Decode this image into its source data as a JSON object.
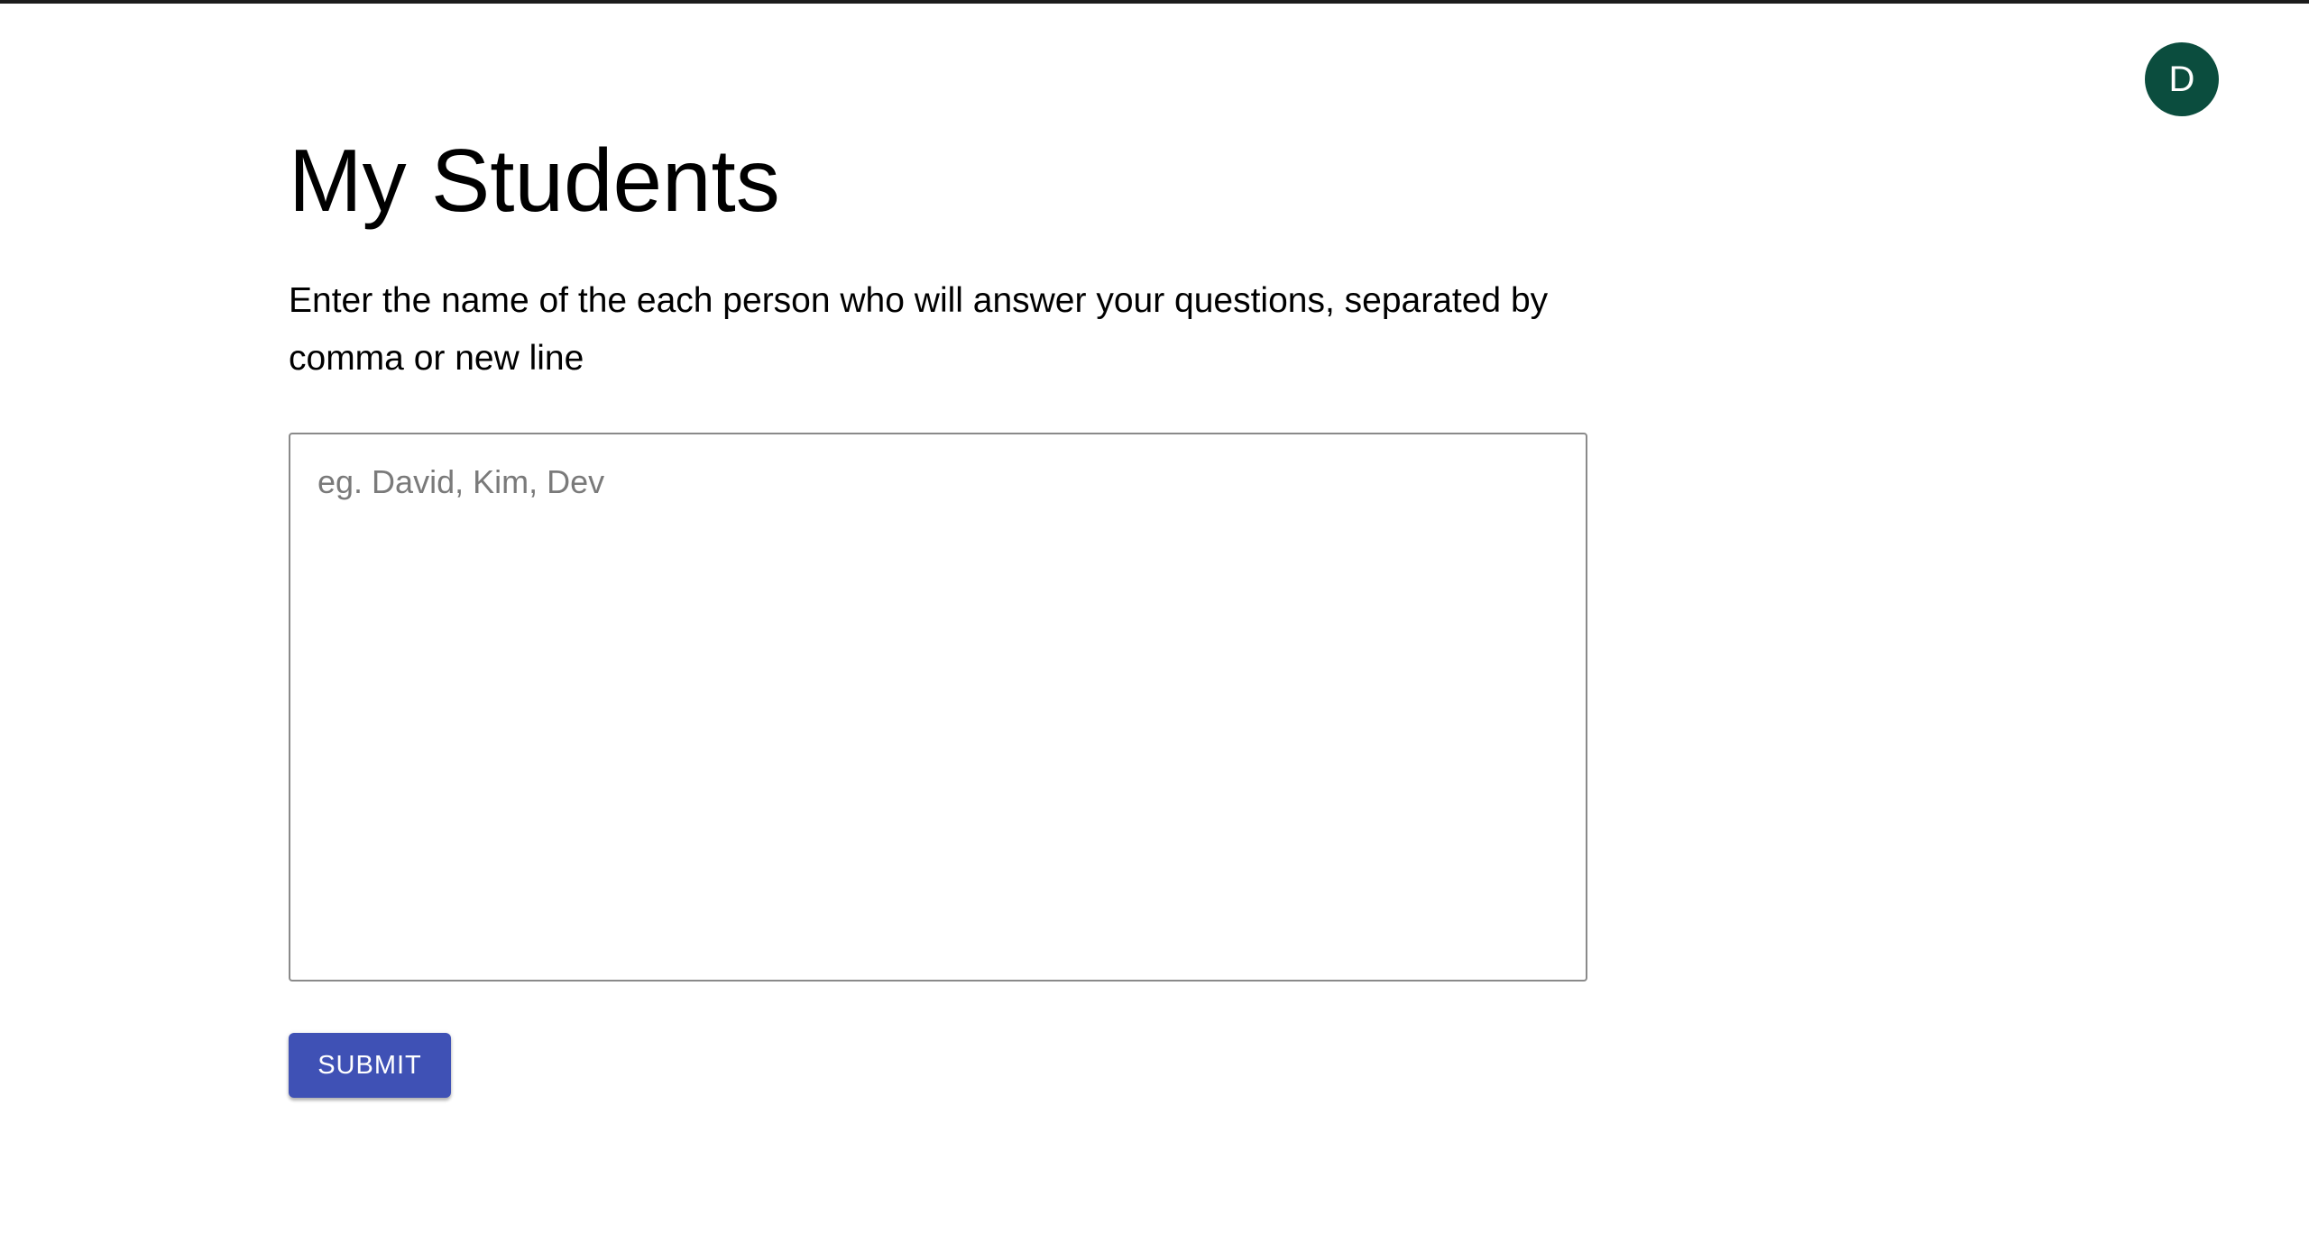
{
  "user": {
    "avatar_initial": "D",
    "avatar_color": "#0b4d3e"
  },
  "page": {
    "title": "My Students",
    "instructions": "Enter the name of the each person who will answer your questions, separated by comma or new line"
  },
  "names_input": {
    "value": "",
    "placeholder": "eg. David, Kim, Dev"
  },
  "actions": {
    "submit_label": "SUBMIT",
    "submit_color": "#3f51b5"
  }
}
